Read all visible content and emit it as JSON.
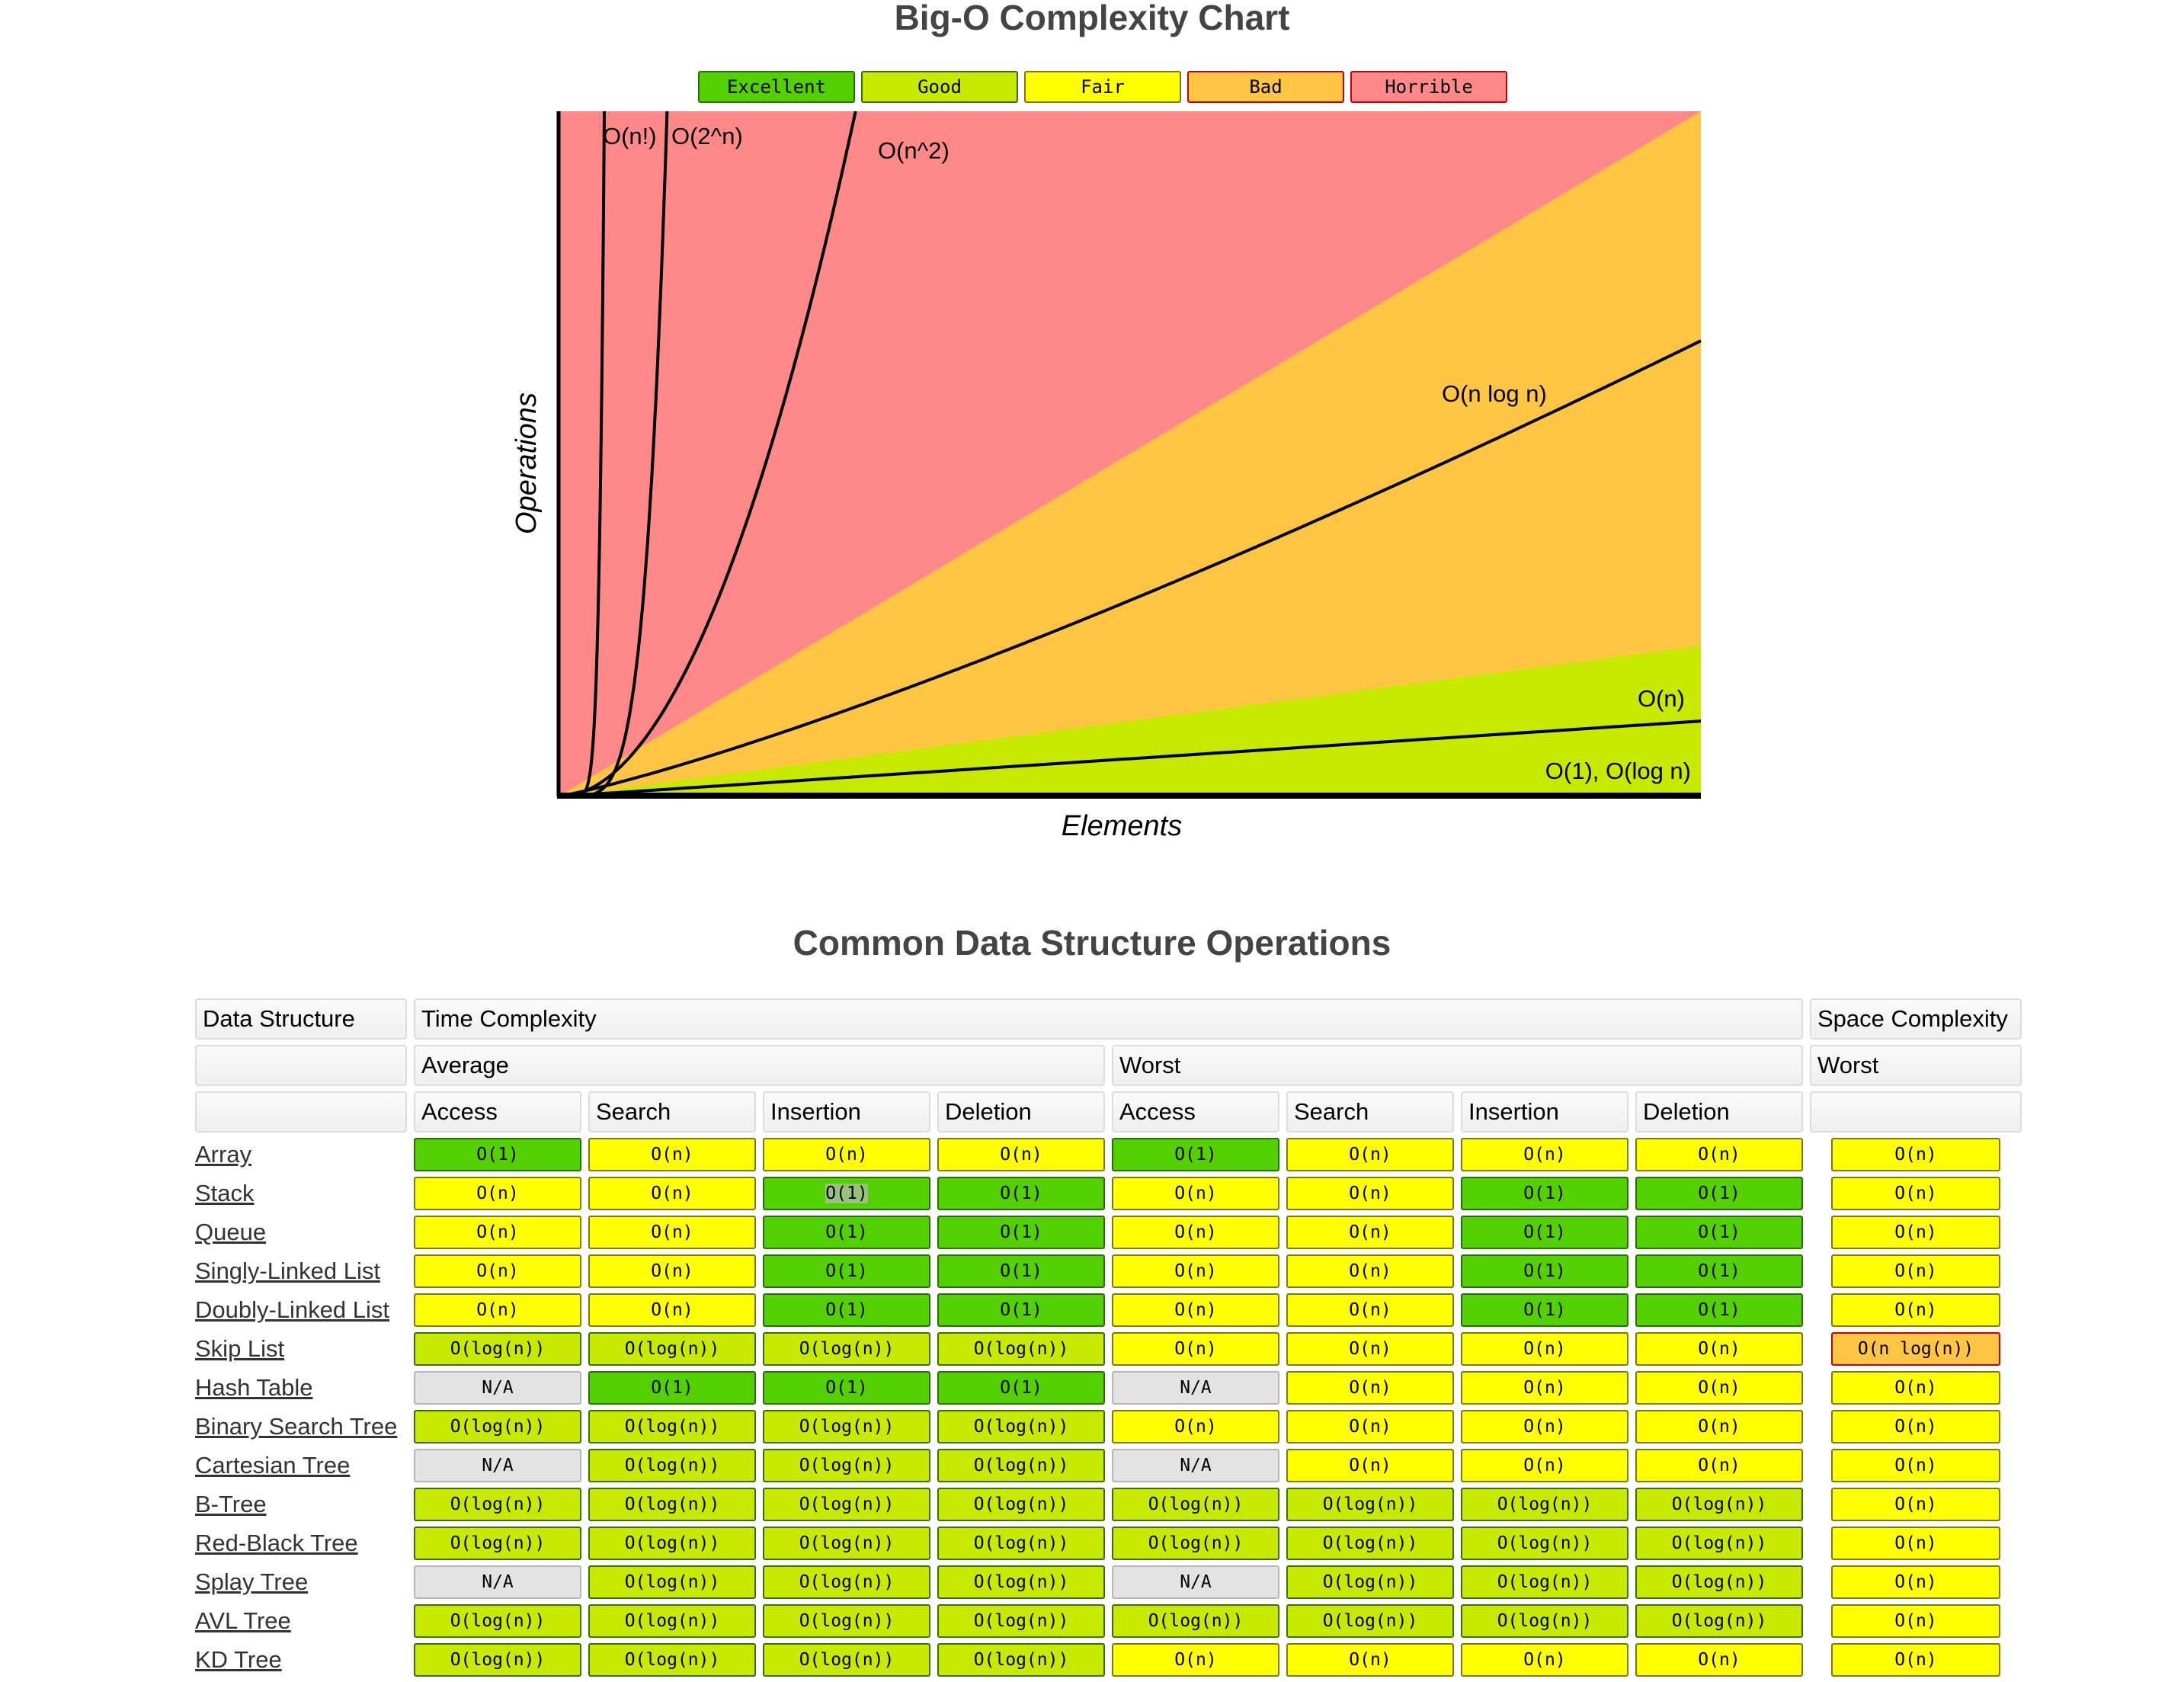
{
  "chart_data": {
    "type": "area",
    "title": "Big-O Complexity Chart",
    "xlabel": "Elements",
    "ylabel": "Operations",
    "grid": false,
    "legend_position": "top-center",
    "legend": [
      {
        "label": "Excellent",
        "color": "#53d000",
        "border": "#2a6e00"
      },
      {
        "label": "Good",
        "color": "#c8ea00",
        "border": "#3a6e00"
      },
      {
        "label": "Fair",
        "color": "#ffff00",
        "border": "#7a7a00"
      },
      {
        "label": "Bad",
        "color": "#ffc543",
        "border": "#c80000"
      },
      {
        "label": "Horrible",
        "color": "#ff8989",
        "border": "#c80000"
      }
    ],
    "xlim": [
      0,
      100
    ],
    "ylim": [
      0,
      100
    ],
    "regions": [
      {
        "name": "Horrible",
        "color": "#ff8989",
        "upper_right_y": 100
      },
      {
        "name": "Bad",
        "color": "#ffc543",
        "upper_right_y": 100
      },
      {
        "name": "Good",
        "color": "#c8ea00",
        "upper_right_y": 22
      },
      {
        "name": "Excellent-floor",
        "color": "#53d000",
        "upper_right_y": 0
      }
    ],
    "series": [
      {
        "name": "O(n!)",
        "label": "O(n!)",
        "x_at_top": 4
      },
      {
        "name": "O(2^n)",
        "label": "O(2^n)",
        "x_at_top": 9.5
      },
      {
        "name": "O(n^2)",
        "label": "O(n^2)",
        "x_at_top": 26
      },
      {
        "name": "O(n log n)",
        "label": "O(n log n)",
        "y_at_right": 66.5
      },
      {
        "name": "O(n)",
        "label": "O(n)",
        "y_at_right": 11
      },
      {
        "name": "O(1), O(log n)",
        "label": "O(1), O(log n)",
        "y_at_right": 0
      }
    ]
  },
  "table": {
    "title": "Common Data Structure Operations",
    "header": {
      "data_structure": "Data Structure",
      "time_complexity": "Time Complexity",
      "space_complexity": "Space Complexity",
      "average": "Average",
      "worst": "Worst",
      "space_worst": "Worst",
      "ops": [
        "Access",
        "Search",
        "Insertion",
        "Deletion"
      ]
    },
    "ratings": {
      "O(1)": "excellent",
      "O(log(n))": "good",
      "O(n)": "fair",
      "O(n log(n))": "bad",
      "N/A": "na"
    },
    "rating_colors": {
      "excellent": {
        "bg": "#53d000",
        "border": "#2a6e00"
      },
      "good": {
        "bg": "#c8ea00",
        "border": "#3a6e00"
      },
      "fair": {
        "bg": "#ffff00",
        "border": "#7a7a00"
      },
      "bad": {
        "bg": "#ffc543",
        "border": "#c80000"
      },
      "na": {
        "bg": "#e3e3e3",
        "border": "#b5b5b5"
      }
    },
    "rows": [
      {
        "name": "Array",
        "avg": [
          "O(1)",
          "O(n)",
          "O(n)",
          "O(n)"
        ],
        "worst": [
          "O(1)",
          "O(n)",
          "O(n)",
          "O(n)"
        ],
        "space": "O(n)"
      },
      {
        "name": "Stack",
        "avg": [
          "O(n)",
          "O(n)",
          "O(1)",
          "O(1)"
        ],
        "worst": [
          "O(n)",
          "O(n)",
          "O(1)",
          "O(1)"
        ],
        "space": "O(n)"
      },
      {
        "name": "Queue",
        "avg": [
          "O(n)",
          "O(n)",
          "O(1)",
          "O(1)"
        ],
        "worst": [
          "O(n)",
          "O(n)",
          "O(1)",
          "O(1)"
        ],
        "space": "O(n)"
      },
      {
        "name": "Singly-Linked List",
        "avg": [
          "O(n)",
          "O(n)",
          "O(1)",
          "O(1)"
        ],
        "worst": [
          "O(n)",
          "O(n)",
          "O(1)",
          "O(1)"
        ],
        "space": "O(n)"
      },
      {
        "name": "Doubly-Linked List",
        "avg": [
          "O(n)",
          "O(n)",
          "O(1)",
          "O(1)"
        ],
        "worst": [
          "O(n)",
          "O(n)",
          "O(1)",
          "O(1)"
        ],
        "space": "O(n)"
      },
      {
        "name": "Skip List",
        "avg": [
          "O(log(n))",
          "O(log(n))",
          "O(log(n))",
          "O(log(n))"
        ],
        "worst": [
          "O(n)",
          "O(n)",
          "O(n)",
          "O(n)"
        ],
        "space": "O(n log(n))"
      },
      {
        "name": "Hash Table",
        "avg": [
          "N/A",
          "O(1)",
          "O(1)",
          "O(1)"
        ],
        "worst": [
          "N/A",
          "O(n)",
          "O(n)",
          "O(n)"
        ],
        "space": "O(n)"
      },
      {
        "name": "Binary Search Tree",
        "avg": [
          "O(log(n))",
          "O(log(n))",
          "O(log(n))",
          "O(log(n))"
        ],
        "worst": [
          "O(n)",
          "O(n)",
          "O(n)",
          "O(n)"
        ],
        "space": "O(n)"
      },
      {
        "name": "Cartesian Tree",
        "avg": [
          "N/A",
          "O(log(n))",
          "O(log(n))",
          "O(log(n))"
        ],
        "worst": [
          "N/A",
          "O(n)",
          "O(n)",
          "O(n)"
        ],
        "space": "O(n)"
      },
      {
        "name": "B-Tree",
        "avg": [
          "O(log(n))",
          "O(log(n))",
          "O(log(n))",
          "O(log(n))"
        ],
        "worst": [
          "O(log(n))",
          "O(log(n))",
          "O(log(n))",
          "O(log(n))"
        ],
        "space": "O(n)"
      },
      {
        "name": "Red-Black Tree",
        "avg": [
          "O(log(n))",
          "O(log(n))",
          "O(log(n))",
          "O(log(n))"
        ],
        "worst": [
          "O(log(n))",
          "O(log(n))",
          "O(log(n))",
          "O(log(n))"
        ],
        "space": "O(n)"
      },
      {
        "name": "Splay Tree",
        "avg": [
          "N/A",
          "O(log(n))",
          "O(log(n))",
          "O(log(n))"
        ],
        "worst": [
          "N/A",
          "O(log(n))",
          "O(log(n))",
          "O(log(n))"
        ],
        "space": "O(n)"
      },
      {
        "name": "AVL Tree",
        "avg": [
          "O(log(n))",
          "O(log(n))",
          "O(log(n))",
          "O(log(n))"
        ],
        "worst": [
          "O(log(n))",
          "O(log(n))",
          "O(log(n))",
          "O(log(n))"
        ],
        "space": "O(n)"
      },
      {
        "name": "KD Tree",
        "avg": [
          "O(log(n))",
          "O(log(n))",
          "O(log(n))",
          "O(log(n))"
        ],
        "worst": [
          "O(n)",
          "O(n)",
          "O(n)",
          "O(n)"
        ],
        "space": "O(n)"
      }
    ],
    "selected_cell": {
      "row": 1,
      "group": "avg",
      "col": 2
    }
  }
}
